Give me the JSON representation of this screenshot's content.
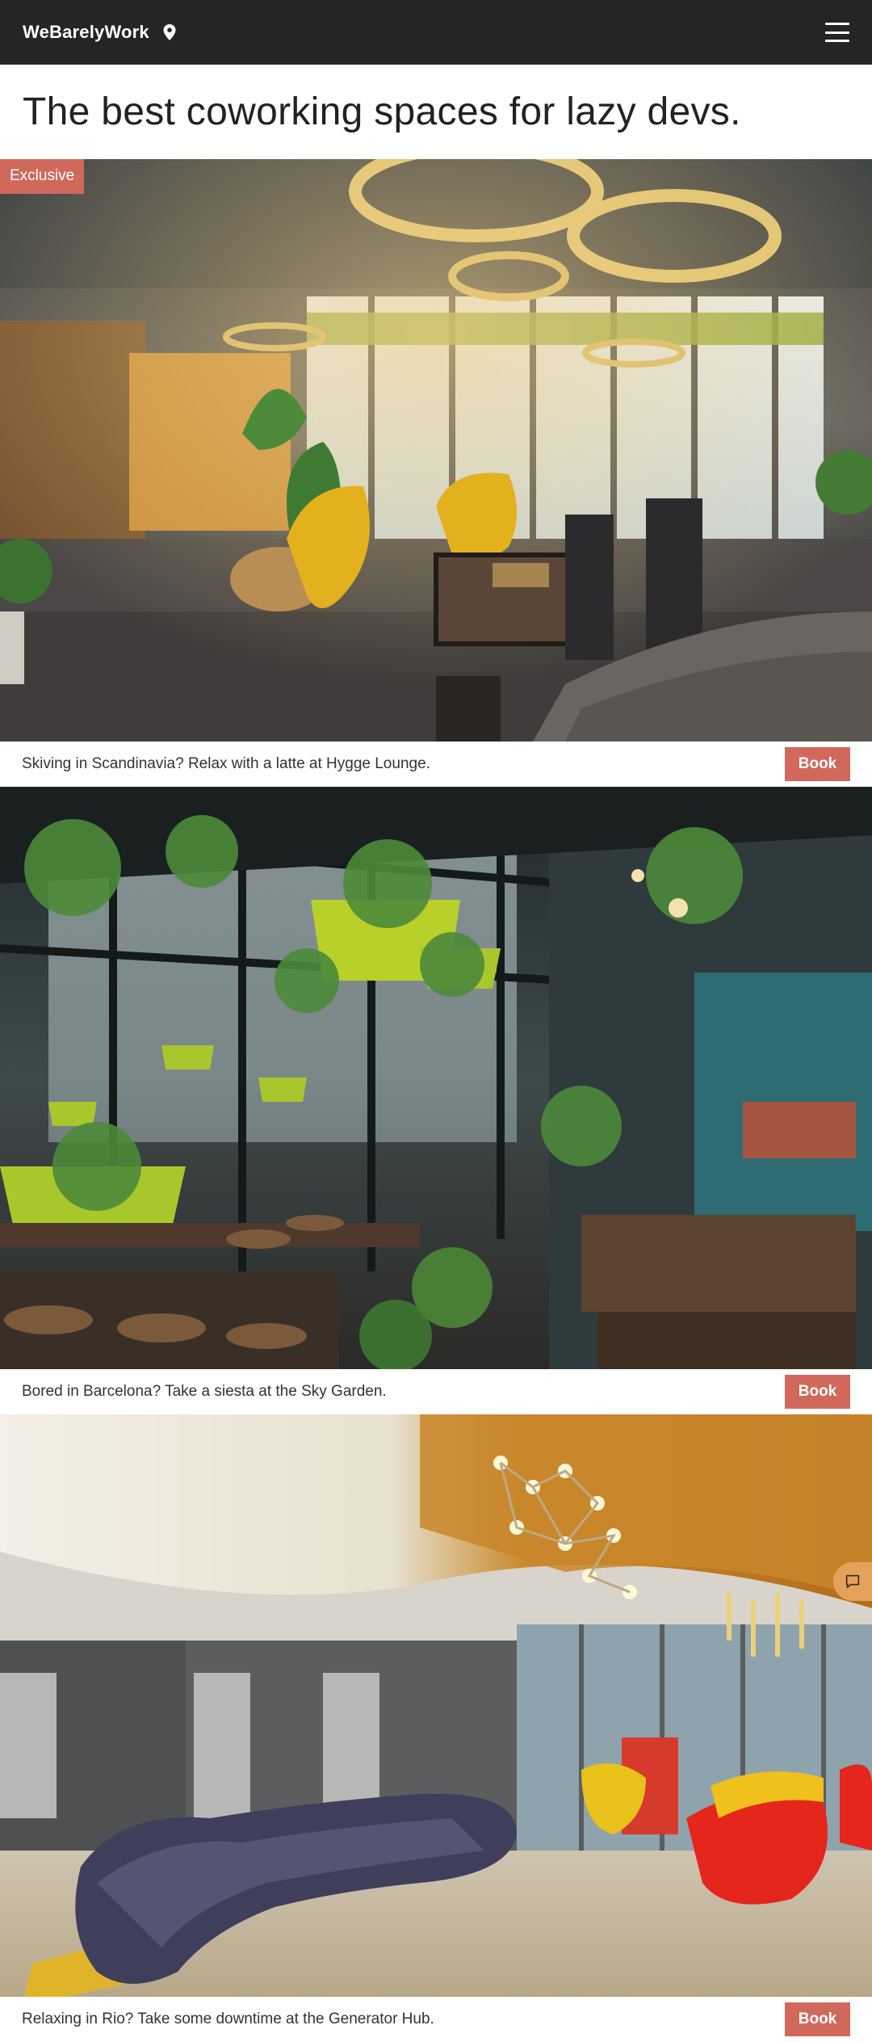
{
  "nav": {
    "brand": "WeBarelyWork",
    "location_icon": "map-pin-icon",
    "menu_icon": "hamburger-menu-icon"
  },
  "headline": "The best coworking spaces for lazy devs.",
  "colors": {
    "navbar": "#252525",
    "accent": "#d0695c",
    "chat": "#e3a15a"
  },
  "listings": [
    {
      "badge": "Exclusive",
      "caption": "Skiving in Scandinavia? Relax with a latte at Hygge Lounge.",
      "button": "Book",
      "photo_description_icon": "coworking-lounge-photo"
    },
    {
      "badge": "",
      "caption": "Bored in Barcelona? Take a siesta at the Sky Garden.",
      "button": "Book",
      "photo_description_icon": "sky-garden-photo"
    },
    {
      "badge": "",
      "caption": "Relaxing in Rio? Take some downtime at the Generator Hub.",
      "button": "Book",
      "photo_description_icon": "generator-hub-photo"
    }
  ],
  "chat_widget": {
    "icon": "chat-icon"
  }
}
